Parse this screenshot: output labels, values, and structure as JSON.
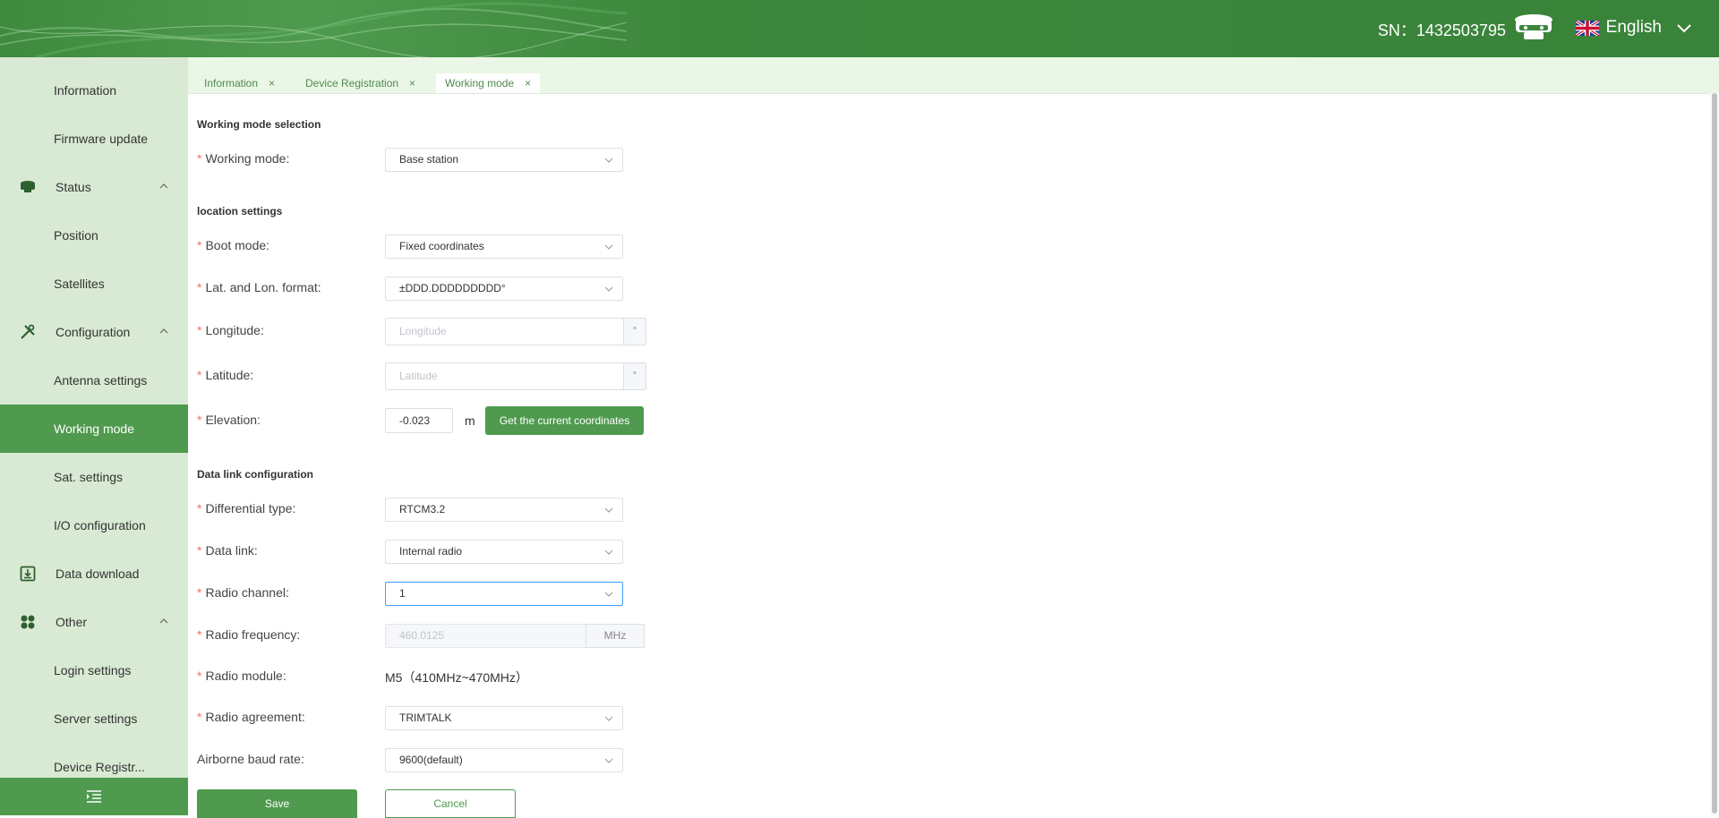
{
  "header": {
    "sn_label": "SN：1432503795",
    "language": "English",
    "device_icon": "receiver-icon",
    "flag_icon": "uk-flag-icon"
  },
  "sidebar": {
    "items": [
      {
        "label": "Information"
      },
      {
        "label": "Firmware update"
      },
      {
        "label": "Status"
      },
      {
        "label": "Position"
      },
      {
        "label": "Satellites"
      },
      {
        "label": "Configuration"
      },
      {
        "label": "Antenna settings"
      },
      {
        "label": "Working mode"
      },
      {
        "label": "Sat. settings"
      },
      {
        "label": "I/O configuration"
      },
      {
        "label": "Data download"
      },
      {
        "label": "Other"
      },
      {
        "label": "Login settings"
      },
      {
        "label": "Server settings"
      },
      {
        "label": "Device Registr..."
      }
    ]
  },
  "tabs": [
    {
      "label": "Information",
      "close": "×"
    },
    {
      "label": "Device Registration",
      "close": "×"
    },
    {
      "label": "Working mode",
      "close": "×"
    }
  ],
  "form": {
    "section_working_mode": "Working mode selection",
    "working_mode_label": "Working mode:",
    "working_mode_value": "Base station",
    "section_location": "location settings",
    "boot_mode_label": "Boot mode:",
    "boot_mode_value": "Fixed coordinates",
    "latlon_format_label": "Lat. and Lon. format:",
    "latlon_format_value": "±DDD.DDDDDDDDD°",
    "longitude_label": "Longitude:",
    "longitude_placeholder": "Longitude",
    "latitude_label": "Latitude:",
    "latitude_placeholder": "Latitude",
    "degree_suffix": "°",
    "elevation_label": "Elevation:",
    "elevation_value": "-0.023",
    "elevation_unit": "m",
    "get_coords_button": "Get the current coordinates",
    "section_data_link": "Data link configuration",
    "diff_type_label": "Differential type:",
    "diff_type_value": "RTCM3.2",
    "data_link_label": "Data link:",
    "data_link_value": "Internal radio",
    "radio_channel_label": "Radio channel:",
    "radio_channel_value": "1",
    "radio_freq_label": "Radio frequency:",
    "radio_freq_value": "460.0125",
    "radio_freq_unit": "MHz",
    "radio_module_label": "Radio module:",
    "radio_module_value": "M5（410MHz~470MHz）",
    "radio_agreement_label": "Radio agreement:",
    "radio_agreement_value": "TRIMTALK",
    "baud_rate_label": "Airborne baud rate:",
    "baud_rate_value": "9600(default)",
    "save_button": "Save",
    "cancel_button": "Cancel",
    "required_mark": "*"
  },
  "colors": {
    "primary_green": "#4f9a4f",
    "sidebar_bg": "#d8ead3",
    "required_red": "#f56c6c"
  }
}
